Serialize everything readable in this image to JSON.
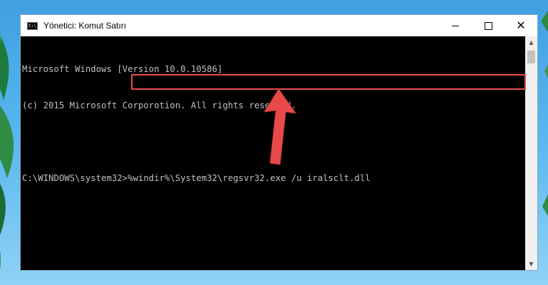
{
  "window": {
    "title": "Yönetici: Komut Satırı",
    "icon_label": "C:\\"
  },
  "console": {
    "lines": [
      "Microsoft Windows [Version 10.0.10586]",
      "(c) 2015 Microsoft Corporotion. All rights reserved.",
      "",
      "C:\\WINDOWS\\system32>%windir%\\System32\\regsvr32.exe /u iralsclt.dll"
    ]
  },
  "colors": {
    "console_bg": "#000000",
    "console_text": "#c0c0c0",
    "highlight": "#e74c4c",
    "arrow": "#e84a4a"
  },
  "icons": {
    "app": "cmd-icon",
    "minimize": "minimize-icon",
    "maximize": "maximize-icon",
    "close": "close-icon",
    "annotation": "red-arrow-icon"
  }
}
